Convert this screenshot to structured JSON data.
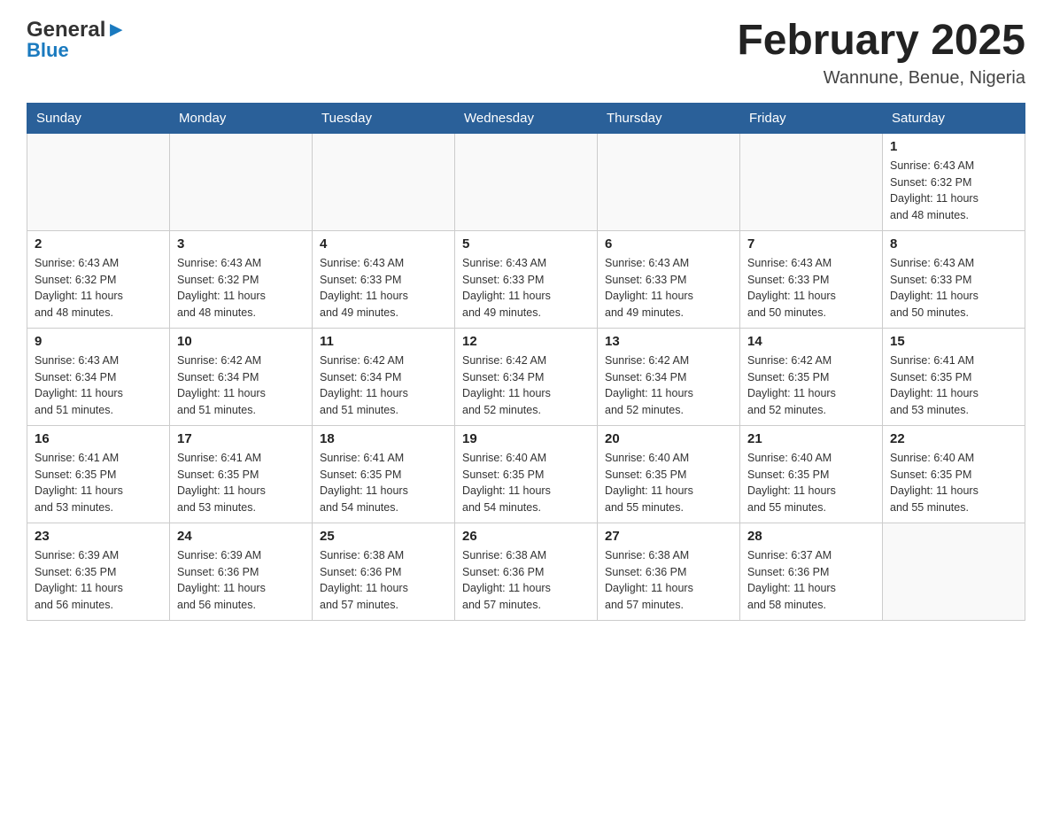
{
  "header": {
    "logo_general": "General",
    "logo_blue": "Blue",
    "month_title": "February 2025",
    "location": "Wannune, Benue, Nigeria"
  },
  "days_of_week": [
    "Sunday",
    "Monday",
    "Tuesday",
    "Wednesday",
    "Thursday",
    "Friday",
    "Saturday"
  ],
  "weeks": [
    [
      {
        "day": "",
        "info": ""
      },
      {
        "day": "",
        "info": ""
      },
      {
        "day": "",
        "info": ""
      },
      {
        "day": "",
        "info": ""
      },
      {
        "day": "",
        "info": ""
      },
      {
        "day": "",
        "info": ""
      },
      {
        "day": "1",
        "info": "Sunrise: 6:43 AM\nSunset: 6:32 PM\nDaylight: 11 hours\nand 48 minutes."
      }
    ],
    [
      {
        "day": "2",
        "info": "Sunrise: 6:43 AM\nSunset: 6:32 PM\nDaylight: 11 hours\nand 48 minutes."
      },
      {
        "day": "3",
        "info": "Sunrise: 6:43 AM\nSunset: 6:32 PM\nDaylight: 11 hours\nand 48 minutes."
      },
      {
        "day": "4",
        "info": "Sunrise: 6:43 AM\nSunset: 6:33 PM\nDaylight: 11 hours\nand 49 minutes."
      },
      {
        "day": "5",
        "info": "Sunrise: 6:43 AM\nSunset: 6:33 PM\nDaylight: 11 hours\nand 49 minutes."
      },
      {
        "day": "6",
        "info": "Sunrise: 6:43 AM\nSunset: 6:33 PM\nDaylight: 11 hours\nand 49 minutes."
      },
      {
        "day": "7",
        "info": "Sunrise: 6:43 AM\nSunset: 6:33 PM\nDaylight: 11 hours\nand 50 minutes."
      },
      {
        "day": "8",
        "info": "Sunrise: 6:43 AM\nSunset: 6:33 PM\nDaylight: 11 hours\nand 50 minutes."
      }
    ],
    [
      {
        "day": "9",
        "info": "Sunrise: 6:43 AM\nSunset: 6:34 PM\nDaylight: 11 hours\nand 51 minutes."
      },
      {
        "day": "10",
        "info": "Sunrise: 6:42 AM\nSunset: 6:34 PM\nDaylight: 11 hours\nand 51 minutes."
      },
      {
        "day": "11",
        "info": "Sunrise: 6:42 AM\nSunset: 6:34 PM\nDaylight: 11 hours\nand 51 minutes."
      },
      {
        "day": "12",
        "info": "Sunrise: 6:42 AM\nSunset: 6:34 PM\nDaylight: 11 hours\nand 52 minutes."
      },
      {
        "day": "13",
        "info": "Sunrise: 6:42 AM\nSunset: 6:34 PM\nDaylight: 11 hours\nand 52 minutes."
      },
      {
        "day": "14",
        "info": "Sunrise: 6:42 AM\nSunset: 6:35 PM\nDaylight: 11 hours\nand 52 minutes."
      },
      {
        "day": "15",
        "info": "Sunrise: 6:41 AM\nSunset: 6:35 PM\nDaylight: 11 hours\nand 53 minutes."
      }
    ],
    [
      {
        "day": "16",
        "info": "Sunrise: 6:41 AM\nSunset: 6:35 PM\nDaylight: 11 hours\nand 53 minutes."
      },
      {
        "day": "17",
        "info": "Sunrise: 6:41 AM\nSunset: 6:35 PM\nDaylight: 11 hours\nand 53 minutes."
      },
      {
        "day": "18",
        "info": "Sunrise: 6:41 AM\nSunset: 6:35 PM\nDaylight: 11 hours\nand 54 minutes."
      },
      {
        "day": "19",
        "info": "Sunrise: 6:40 AM\nSunset: 6:35 PM\nDaylight: 11 hours\nand 54 minutes."
      },
      {
        "day": "20",
        "info": "Sunrise: 6:40 AM\nSunset: 6:35 PM\nDaylight: 11 hours\nand 55 minutes."
      },
      {
        "day": "21",
        "info": "Sunrise: 6:40 AM\nSunset: 6:35 PM\nDaylight: 11 hours\nand 55 minutes."
      },
      {
        "day": "22",
        "info": "Sunrise: 6:40 AM\nSunset: 6:35 PM\nDaylight: 11 hours\nand 55 minutes."
      }
    ],
    [
      {
        "day": "23",
        "info": "Sunrise: 6:39 AM\nSunset: 6:35 PM\nDaylight: 11 hours\nand 56 minutes."
      },
      {
        "day": "24",
        "info": "Sunrise: 6:39 AM\nSunset: 6:36 PM\nDaylight: 11 hours\nand 56 minutes."
      },
      {
        "day": "25",
        "info": "Sunrise: 6:38 AM\nSunset: 6:36 PM\nDaylight: 11 hours\nand 57 minutes."
      },
      {
        "day": "26",
        "info": "Sunrise: 6:38 AM\nSunset: 6:36 PM\nDaylight: 11 hours\nand 57 minutes."
      },
      {
        "day": "27",
        "info": "Sunrise: 6:38 AM\nSunset: 6:36 PM\nDaylight: 11 hours\nand 57 minutes."
      },
      {
        "day": "28",
        "info": "Sunrise: 6:37 AM\nSunset: 6:36 PM\nDaylight: 11 hours\nand 58 minutes."
      },
      {
        "day": "",
        "info": ""
      }
    ]
  ]
}
